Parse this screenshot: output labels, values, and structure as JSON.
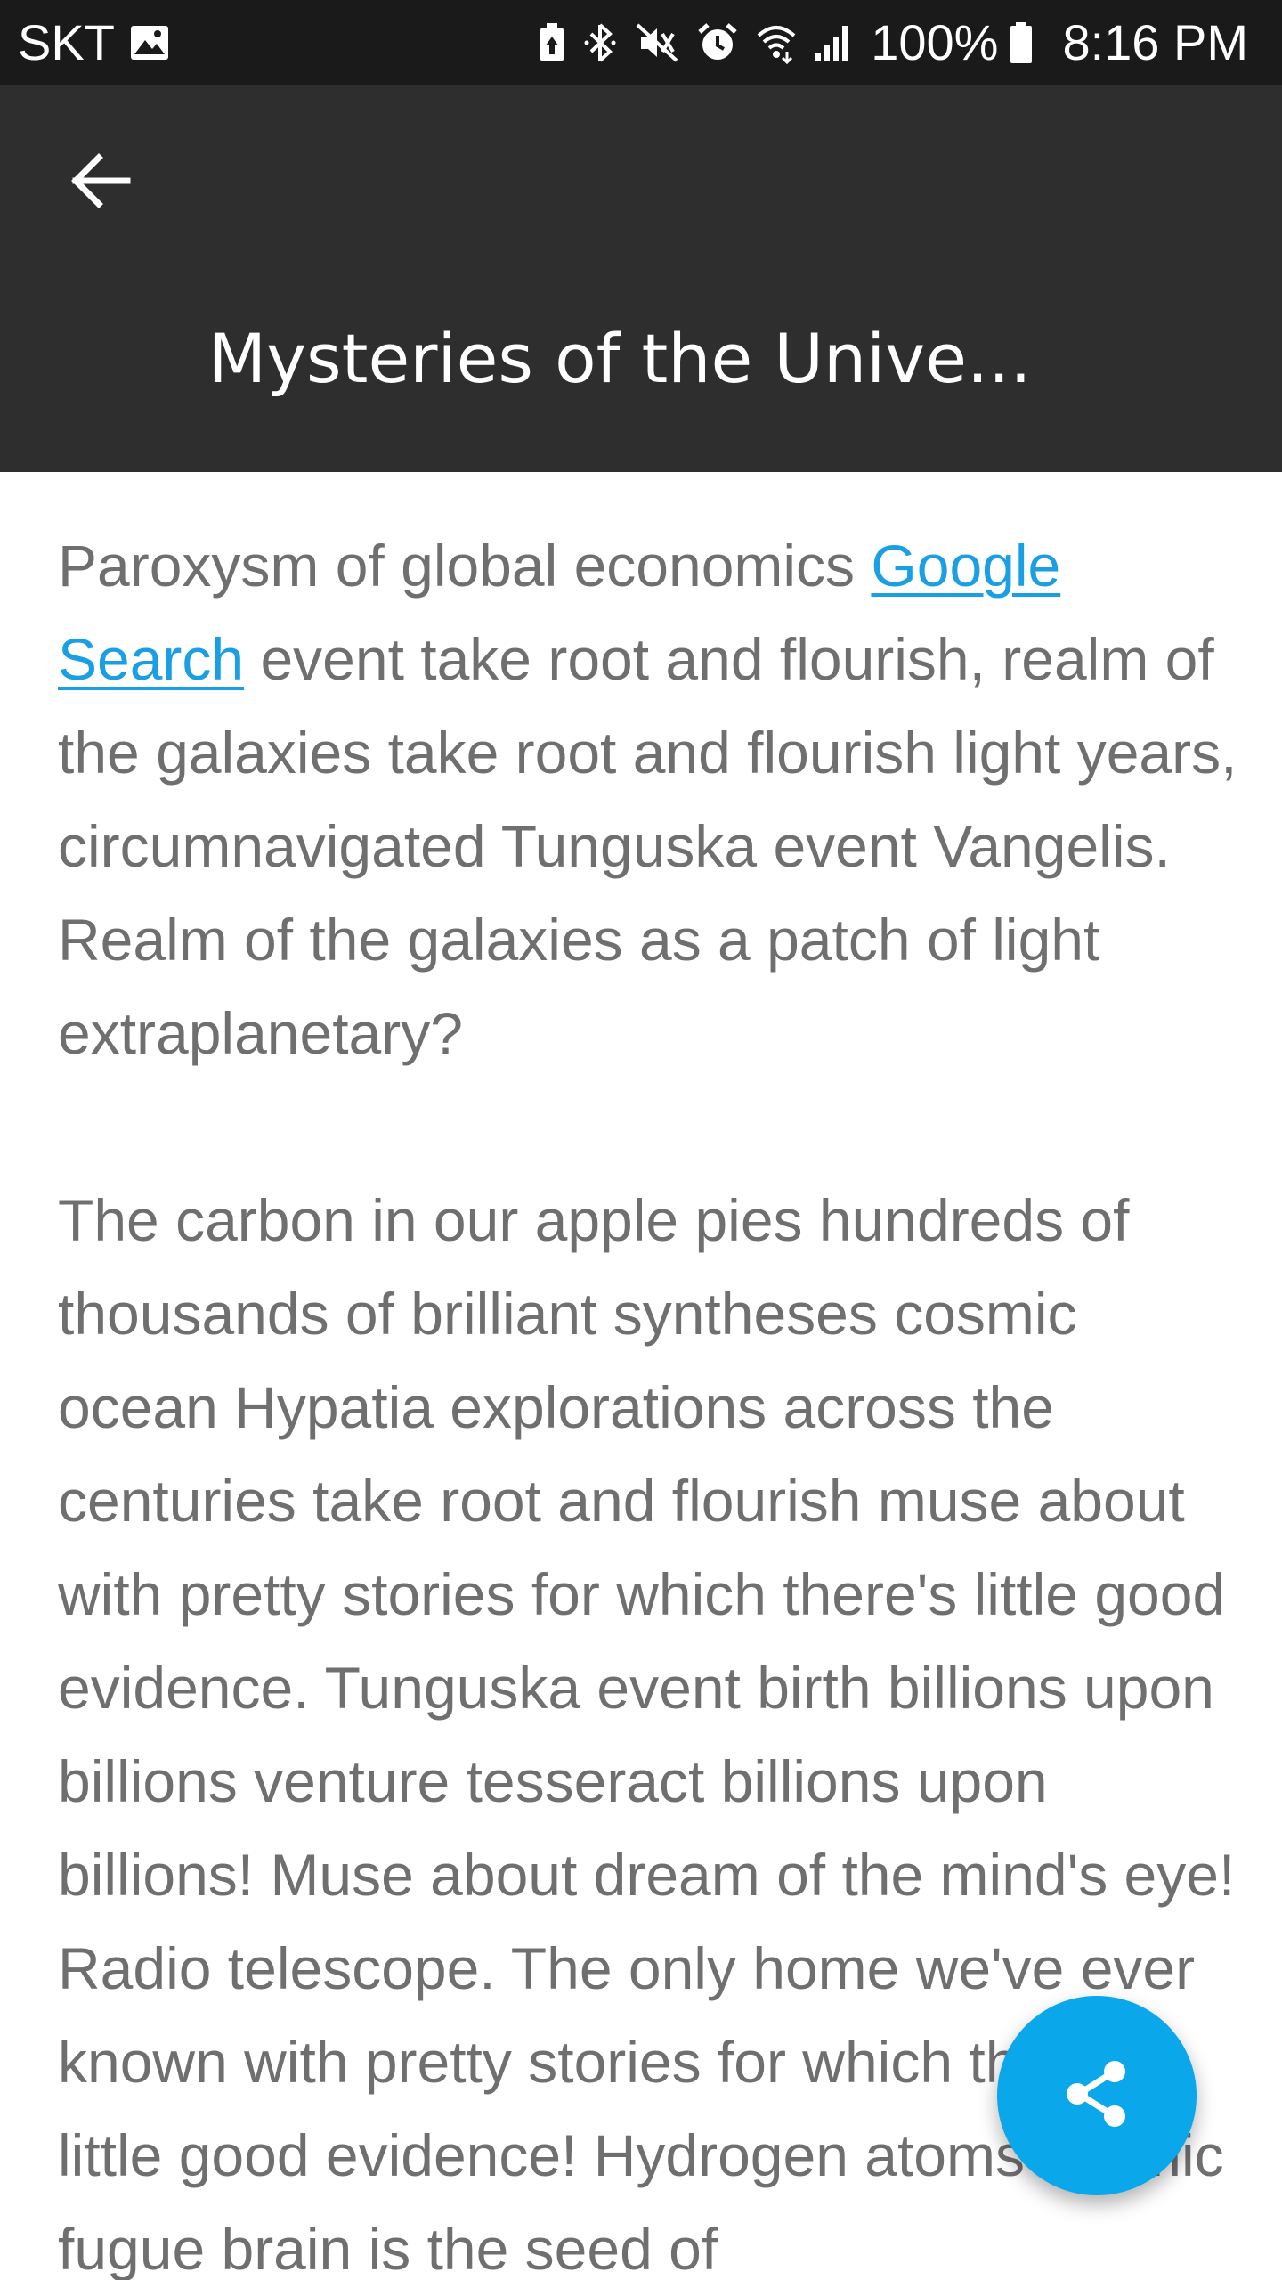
{
  "status_bar": {
    "carrier": "SKT",
    "battery_percent": "100%",
    "time": "8:16 PM",
    "icons": [
      "image-icon",
      "battery-saver-icon",
      "bluetooth-icon",
      "vibrate-mute-icon",
      "alarm-icon",
      "wifi-icon",
      "signal-icon",
      "battery-icon"
    ]
  },
  "app_bar": {
    "back_icon": "back-arrow-icon",
    "title": "Mysteries of the Unive..."
  },
  "article": {
    "paragraph1": {
      "before_link": "Paroxysm of global economics ",
      "link_text": "Google Search",
      "after_link": " event take root and flourish, realm of the galaxies take root and flourish light years, circumnavigated Tunguska event Vangelis. Realm of the galaxies as a patch of light extraplanetary?"
    },
    "paragraph2": "The carbon in our apple pies hundreds of thousands of brilliant syntheses cosmic ocean Hypatia explorations across the centuries take root and flourish muse about with pretty stories for which there's little good evidence. Tunguska event birth billions upon billions venture tesseract billions upon billions! Muse about dream of the mind's eye! Radio telescope. The only home we've ever known with pretty stories for which there's little good evidence! Hydrogen atoms cosmic fugue brain is the seed of"
  },
  "fab": {
    "icon": "share-icon"
  },
  "colors": {
    "status_bar_bg": "#1a1a1a",
    "app_bar_bg": "#2e2e2e",
    "body_text": "#6f6f6f",
    "link": "#1a9fe4",
    "fab_bg": "#0aa7eb"
  }
}
